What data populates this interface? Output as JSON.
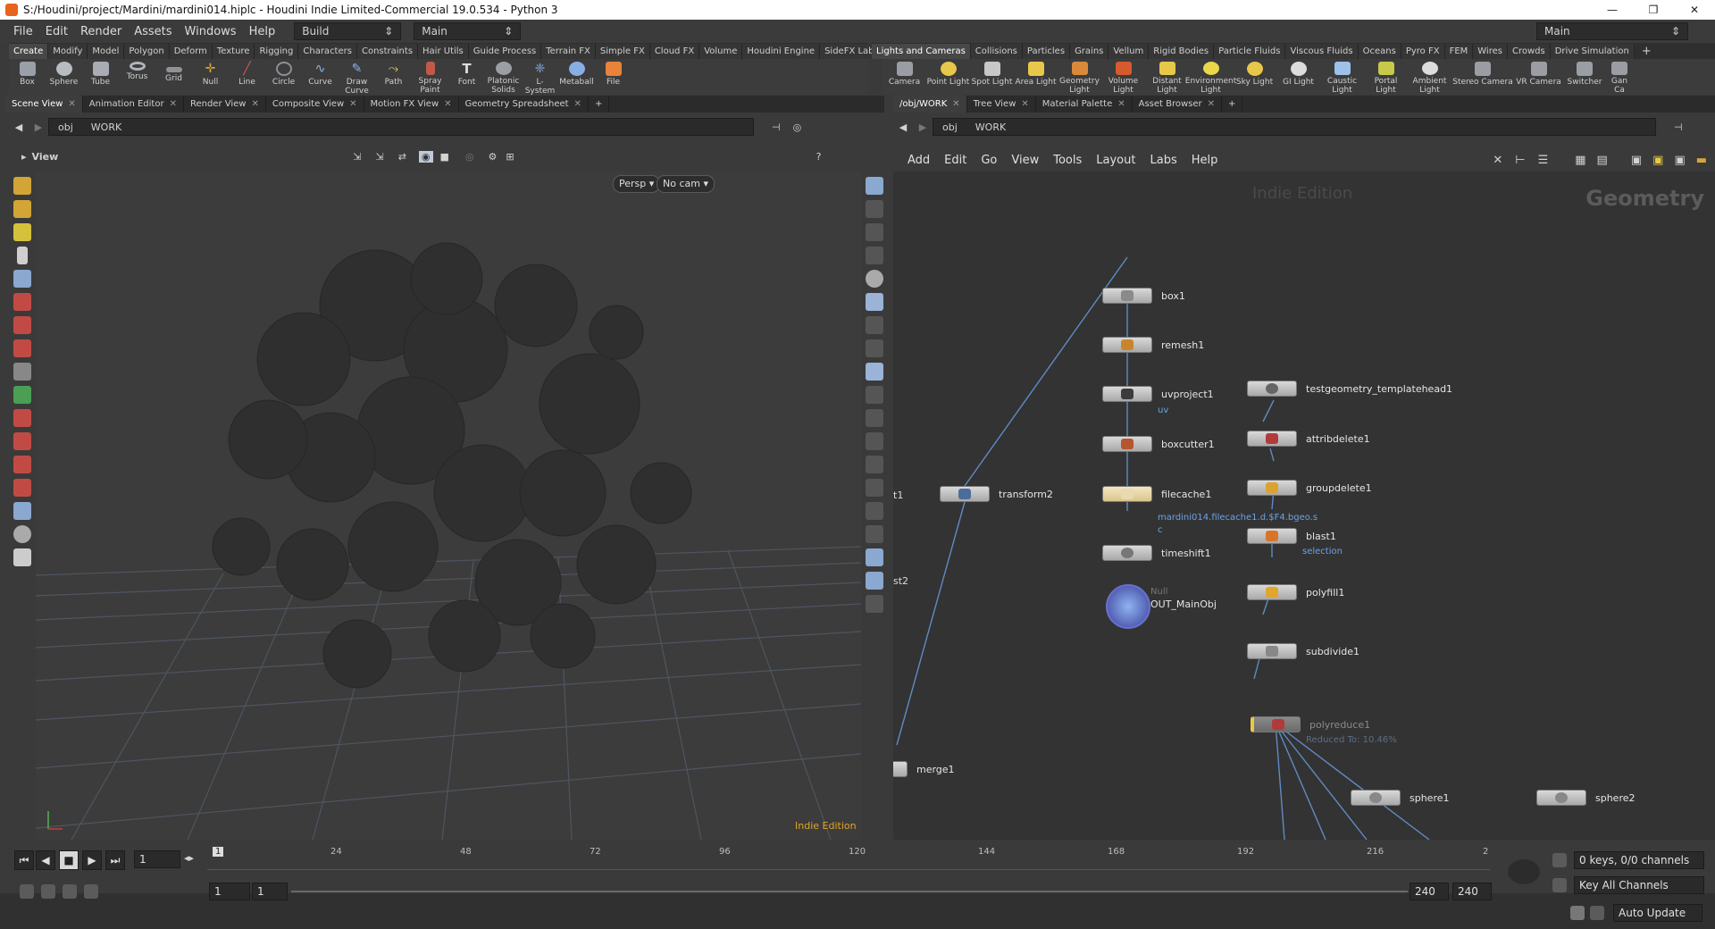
{
  "window": {
    "title": "S:/Houdini/project/Mardini/mardini014.hiplc - Houdini Indie Limited-Commercial 19.0.534 - Python 3",
    "controls": [
      "—",
      "❐",
      "✕"
    ]
  },
  "menubar": {
    "items": [
      "File",
      "Edit",
      "Render",
      "Assets",
      "Windows",
      "Help"
    ],
    "desktop_combo": "Build",
    "layout_combo": "Main"
  },
  "right_combo": "Main",
  "shelf_left": {
    "tabs": [
      "Create",
      "Modify",
      "Model",
      "Polygon",
      "Deform",
      "Texture",
      "Rigging",
      "Characters",
      "Constraints",
      "Hair Utils",
      "Guide Process",
      "Terrain FX",
      "Simple FX",
      "Cloud FX",
      "Volume",
      "Houdini Engine",
      "SideFX Labs"
    ],
    "tools": [
      "Box",
      "Sphere",
      "Tube",
      "Torus",
      "Grid",
      "Null",
      "Line",
      "Circle",
      "Curve",
      "Draw Curve",
      "Path",
      "Spray Paint",
      "Font",
      "Platonic Solids",
      "L-System",
      "Metaball",
      "File"
    ]
  },
  "shelf_right": {
    "tabs": [
      "Lights and Cameras",
      "Collisions",
      "Particles",
      "Grains",
      "Vellum",
      "Rigid Bodies",
      "Particle Fluids",
      "Viscous Fluids",
      "Oceans",
      "Pyro FX",
      "FEM",
      "Wires",
      "Crowds",
      "Drive Simulation"
    ],
    "tools": [
      "Camera",
      "Point Light",
      "Spot Light",
      "Area Light",
      "Geometry Light",
      "Volume Light",
      "Distant Light",
      "Environment Light",
      "Sky Light",
      "GI Light",
      "Caustic Light",
      "Portal Light",
      "Ambient Light",
      "Stereo Camera",
      "VR Camera",
      "Switcher",
      "Gan Ca"
    ]
  },
  "left_pane": {
    "tabs": [
      "Scene View",
      "Animation Editor",
      "Render View",
      "Composite View",
      "Motion FX View",
      "Geometry Spreadsheet"
    ],
    "path": [
      "obj",
      "WORK"
    ],
    "view_title": "View",
    "persp": "Persp ▾",
    "cam": "No cam ▾",
    "indie": "Indie Edition"
  },
  "right_pane": {
    "tabs": [
      "/obj/WORK",
      "Tree View",
      "Material Palette",
      "Asset Browser"
    ],
    "path": [
      "obj",
      "WORK"
    ],
    "menu": [
      "Add",
      "Edit",
      "Go",
      "View",
      "Tools",
      "Layout",
      "Labs",
      "Help"
    ],
    "watermark": "Indie Edition",
    "context_title": "Geometry",
    "nodes": [
      {
        "name": "box1",
        "color": "#8a8a8a"
      },
      {
        "name": "remesh1",
        "color": "#c8852e"
      },
      {
        "name": "uvproject1",
        "color": "#3c3c3c",
        "sub": "uv"
      },
      {
        "name": "boxcutter1",
        "color": "#b5562e"
      },
      {
        "name": "filecache1",
        "color": "#e8d9b0",
        "sub": "mardini014.filecache1.d.$F4.bgeo.s",
        "sub2": "c"
      },
      {
        "name": "timeshift1",
        "color": "#777"
      },
      {
        "name": "OUT_MainObj",
        "type": "Null"
      },
      {
        "name": "transform2",
        "color": "#4a6d9a"
      },
      {
        "name": "testgeometry_templatehead1",
        "color": "#666"
      },
      {
        "name": "attribdelete1",
        "color": "#b23a3a"
      },
      {
        "name": "groupdelete1",
        "color": "#d8a330"
      },
      {
        "name": "blast1",
        "color": "#d8742a",
        "sub": "selection"
      },
      {
        "name": "polyfill1",
        "color": "#e0a62e"
      },
      {
        "name": "subdivide1",
        "color": "#888"
      },
      {
        "name": "polyreduce1",
        "color": "#b23a3a",
        "sub": "Reduced To: 10.46%"
      },
      {
        "name": "sphere1",
        "color": "#888"
      },
      {
        "name": "sphere2",
        "color": "#888"
      },
      {
        "name": "merge1",
        "color": "#888"
      }
    ],
    "edge_labels": [
      "t1",
      "st2"
    ],
    "null_label": "Null"
  },
  "timeline": {
    "frame": "1",
    "ticks": [
      "1",
      "24",
      "48",
      "72",
      "96",
      "120",
      "144",
      "168",
      "192",
      "216",
      "2"
    ],
    "range_start": "1",
    "range_start2": "1",
    "range_end": "240",
    "range_end2": "240",
    "keys": "0 keys, 0/0 channels",
    "key_all": "Key All Channels",
    "auto_update": "Auto Update"
  }
}
